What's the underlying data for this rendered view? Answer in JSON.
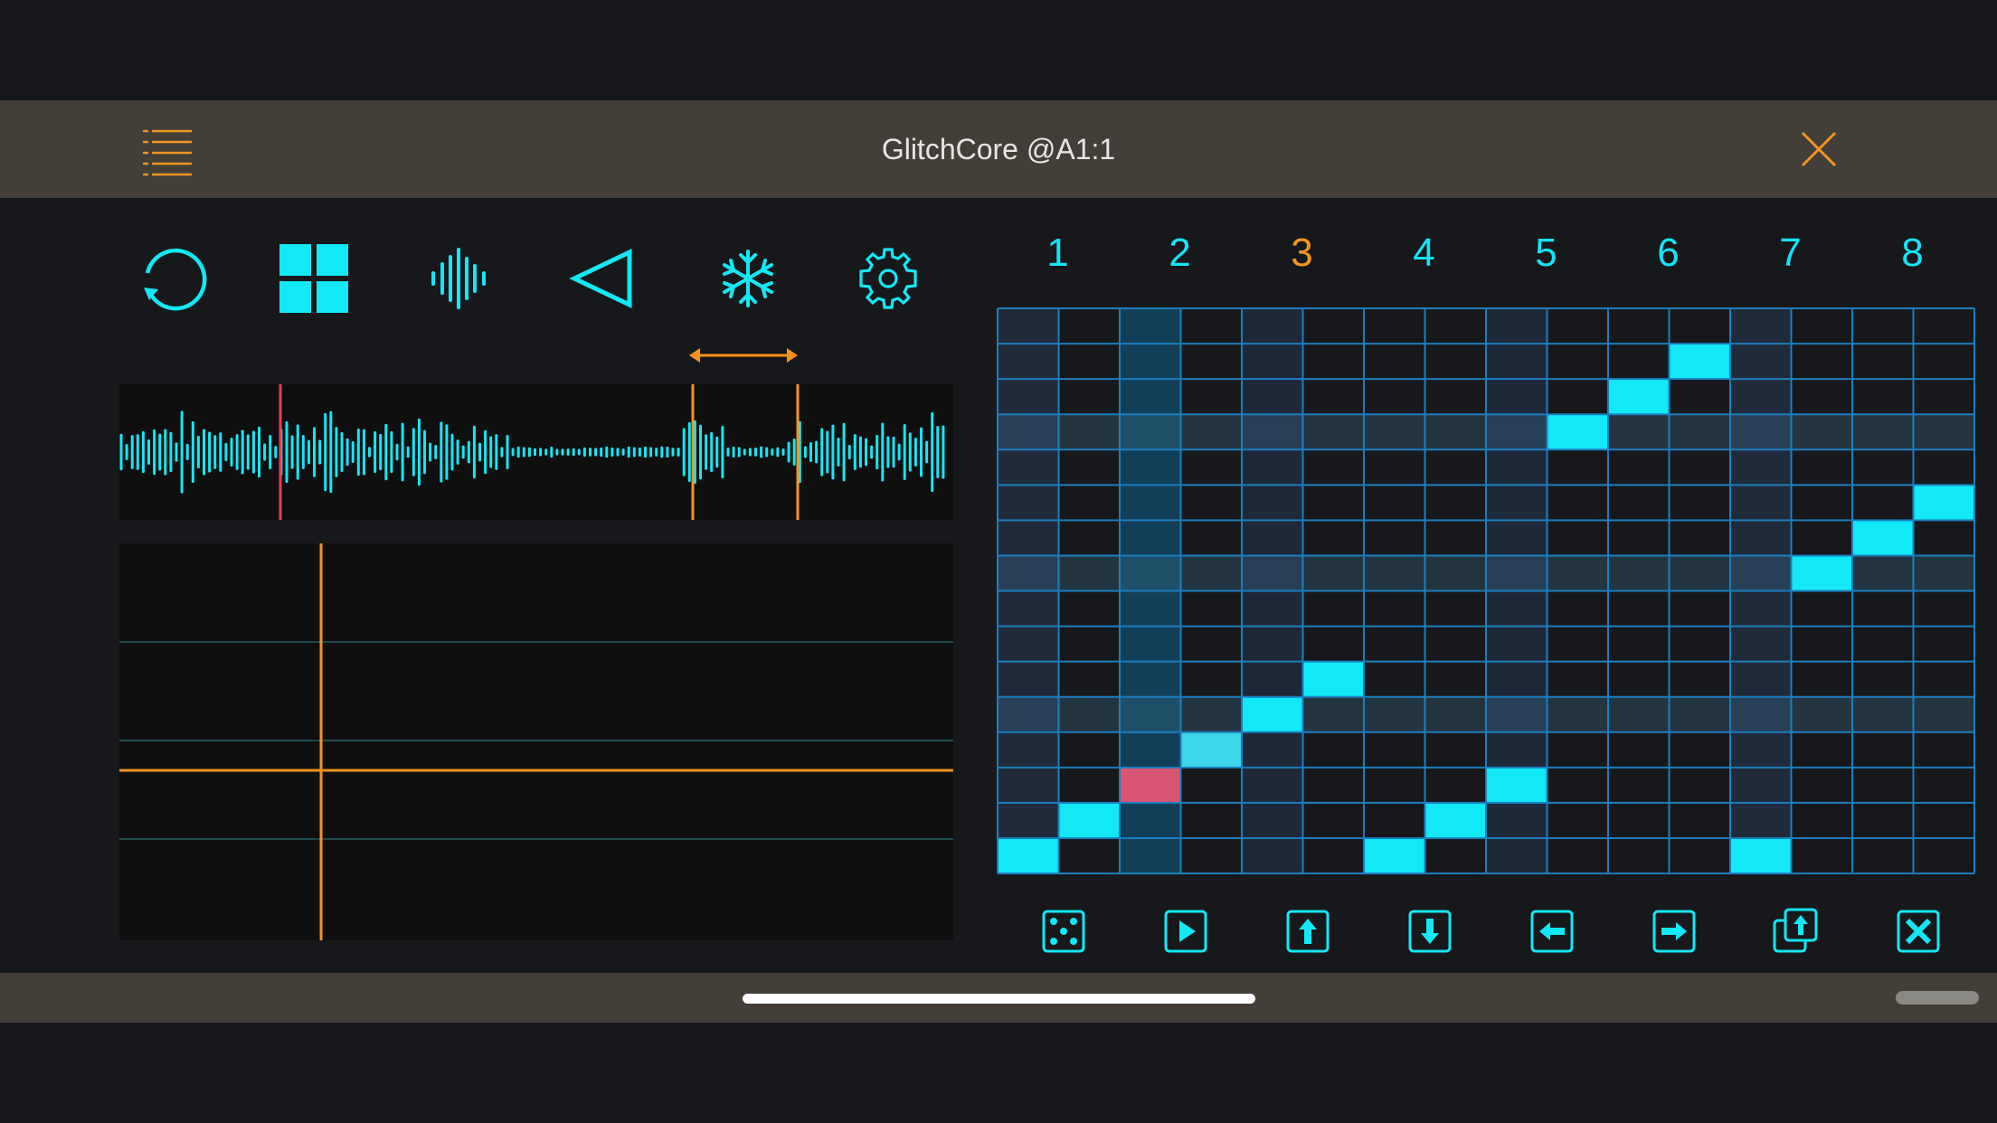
{
  "header": {
    "title": "GlitchCore @A1:1",
    "menu_icon": "list-icon",
    "close_icon": "close-icon"
  },
  "toolbar": {
    "buttons": [
      {
        "name": "reset-button",
        "icon": "rotate-icon"
      },
      {
        "name": "grid-mode-button",
        "icon": "grid-icon"
      },
      {
        "name": "waveform-button",
        "icon": "waveform-icon"
      },
      {
        "name": "reverse-button",
        "icon": "triangle-left-icon"
      },
      {
        "name": "freeze-button",
        "icon": "snowflake-icon"
      },
      {
        "name": "settings-button",
        "icon": "gear-icon"
      }
    ]
  },
  "sequencer": {
    "columns": [
      "1",
      "2",
      "3",
      "4",
      "5",
      "6",
      "7",
      "8"
    ],
    "active_column": 3,
    "rows": 16,
    "steps": 16,
    "active_cells": [
      {
        "step": 1,
        "row": 16
      },
      {
        "step": 2,
        "row": 15
      },
      {
        "step": 3,
        "row": 14,
        "state": "playhead"
      },
      {
        "step": 4,
        "row": 13,
        "state": "light"
      },
      {
        "step": 5,
        "row": 12
      },
      {
        "step": 6,
        "row": 11
      },
      {
        "step": 7,
        "row": 16
      },
      {
        "step": 8,
        "row": 15
      },
      {
        "step": 9,
        "row": 14
      },
      {
        "step": 10,
        "row": 4
      },
      {
        "step": 11,
        "row": 3
      },
      {
        "step": 12,
        "row": 2
      },
      {
        "step": 13,
        "row": 16
      },
      {
        "step": 14,
        "row": 8
      },
      {
        "step": 15,
        "row": 7
      },
      {
        "step": 16,
        "row": 6
      }
    ]
  },
  "pattern_buttons": [
    {
      "name": "randomize-button",
      "icon": "dice-icon"
    },
    {
      "name": "play-button",
      "icon": "play-icon"
    },
    {
      "name": "shift-up-button",
      "icon": "arrow-up-icon"
    },
    {
      "name": "shift-down-button",
      "icon": "arrow-down-icon"
    },
    {
      "name": "shift-left-button",
      "icon": "arrow-left-icon"
    },
    {
      "name": "shift-right-button",
      "icon": "arrow-right-icon"
    },
    {
      "name": "copy-button",
      "icon": "copy-icon"
    },
    {
      "name": "clear-button",
      "icon": "clear-icon"
    }
  ],
  "colors": {
    "accent": "#12e8f6",
    "orange": "#f4941f",
    "pink": "#d85573",
    "header_bg": "#433f38",
    "background": "#17181b"
  }
}
